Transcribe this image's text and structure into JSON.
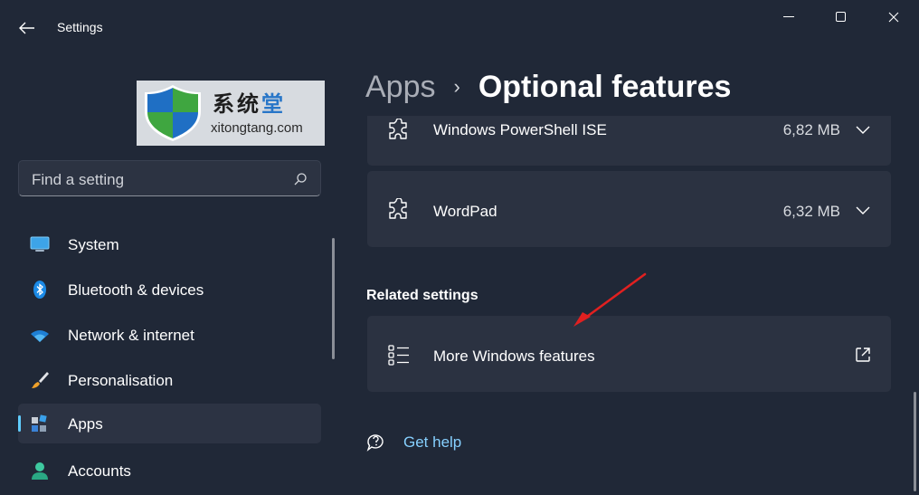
{
  "window": {
    "title": "Settings"
  },
  "watermark": {
    "chinese": "系统堂",
    "latin": "xitongtang.com"
  },
  "search": {
    "placeholder": "Find a setting"
  },
  "sidebar": {
    "items": [
      {
        "label": "System",
        "icon": "monitor-icon",
        "selected": false
      },
      {
        "label": "Bluetooth & devices",
        "icon": "bluetooth-icon",
        "selected": false
      },
      {
        "label": "Network & internet",
        "icon": "wifi-icon",
        "selected": false
      },
      {
        "label": "Personalisation",
        "icon": "paintbrush-icon",
        "selected": false
      },
      {
        "label": "Apps",
        "icon": "apps-icon",
        "selected": true
      },
      {
        "label": "Accounts",
        "icon": "person-icon",
        "selected": false
      }
    ]
  },
  "breadcrumb": {
    "parent": "Apps",
    "separator": "›",
    "current": "Optional features"
  },
  "features": [
    {
      "name": "Windows PowerShell ISE",
      "size": "6,82 MB"
    },
    {
      "name": "WordPad",
      "size": "6,32 MB"
    }
  ],
  "related": {
    "title": "Related settings",
    "more_windows_features": "More Windows features"
  },
  "help": {
    "label": "Get help"
  },
  "colors": {
    "background": "#202837",
    "card": "#2b3241",
    "accent": "#60cdff",
    "link": "#86d0ff",
    "annotation_arrow": "#e02020"
  }
}
